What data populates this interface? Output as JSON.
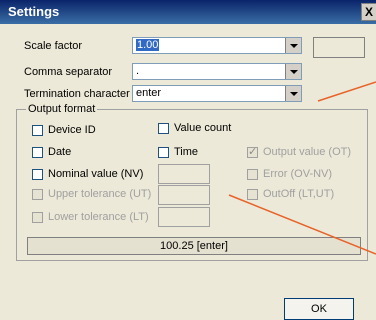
{
  "window": {
    "title": "Settings",
    "close_label": "X"
  },
  "fields": {
    "scale_factor": {
      "label": "Scale factor",
      "value": "1.00"
    },
    "comma_separator": {
      "label": "Comma separator",
      "value": "."
    },
    "termination": {
      "label": "Termination character",
      "value": "enter"
    }
  },
  "output_format": {
    "title": "Output format",
    "device_id": "Device ID",
    "value_count": "Value count",
    "date": "Date",
    "time": "Time",
    "output_value": "Output value (OT)",
    "nominal_value": "Nominal value (NV)",
    "error": "Error (OV-NV)",
    "upper_tolerance": "Upper tolerance (UT)",
    "outoff": "OutOff (LT,UT)",
    "lower_tolerance": "Lower tolerance (LT)"
  },
  "preview": "100.25  [enter]",
  "ok_label": "OK",
  "colors": {
    "titlebar": "#0a246a",
    "accent_line": "#e8622a"
  }
}
